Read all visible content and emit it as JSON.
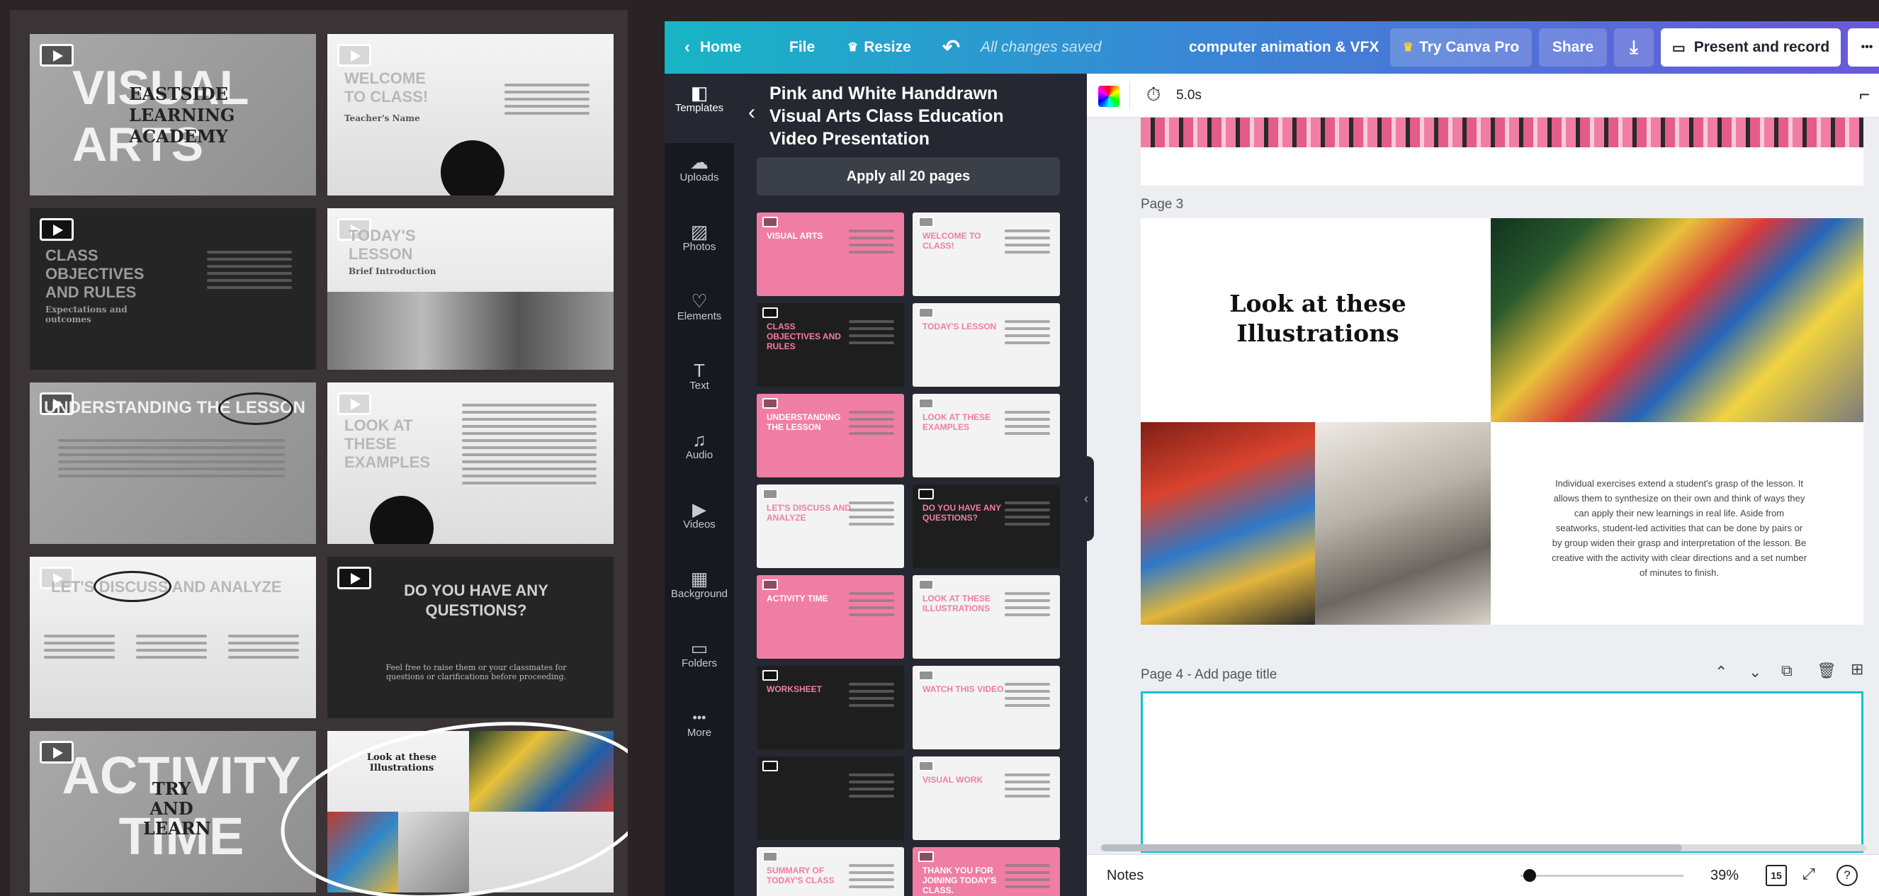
{
  "zoom_panel": {
    "slides": [
      {
        "title_big": "VISUAL ARTS",
        "subtitle": "EASTSIDE LEARNING ACADEMY"
      },
      {
        "title": "WELCOME TO CLASS!",
        "subtitle": "Teacher's Name"
      },
      {
        "title": "CLASS OBJECTIVES AND RULES",
        "subtitle": "Expectations and outcomes"
      },
      {
        "title": "TODAY'S LESSON",
        "subtitle": "Brief Introduction"
      },
      {
        "title": "UNDERSTANDING THE LESSON"
      },
      {
        "title": "LOOK AT THESE EXAMPLES"
      },
      {
        "title": "LET'S DISCUSS AND ANALYZE"
      },
      {
        "title": "DO YOU HAVE ANY QUESTIONS?",
        "subtitle": "Feel free to raise them or your classmates for questions or clarifications before proceeding."
      },
      {
        "title_big": "ACTIVITY TIME",
        "subtitle": "TRY AND LEARN"
      },
      {
        "title": "Look at these Illustrations"
      }
    ]
  },
  "topbar": {
    "home": "Home",
    "file": "File",
    "resize": "Resize",
    "saved": "All changes saved",
    "doc_title": "computer animation & VFX",
    "try_pro": "Try Canva Pro",
    "share": "Share",
    "present": "Present and record",
    "more": "•••"
  },
  "rail": {
    "items": [
      {
        "label": "Templates",
        "icon": "templates-icon",
        "glyph": "◧"
      },
      {
        "label": "Uploads",
        "icon": "upload-cloud-icon",
        "glyph": "☁"
      },
      {
        "label": "Photos",
        "icon": "photo-icon",
        "glyph": "▨"
      },
      {
        "label": "Elements",
        "icon": "shapes-icon",
        "glyph": "♡"
      },
      {
        "label": "Text",
        "icon": "text-icon",
        "glyph": "T"
      },
      {
        "label": "Audio",
        "icon": "music-note-icon",
        "glyph": "♫"
      },
      {
        "label": "Videos",
        "icon": "video-icon",
        "glyph": "▶"
      },
      {
        "label": "Background",
        "icon": "background-pattern-icon",
        "glyph": "▦"
      },
      {
        "label": "Folders",
        "icon": "folder-icon",
        "glyph": "▭"
      },
      {
        "label": "More",
        "icon": "more-dots-icon",
        "glyph": "•••"
      }
    ]
  },
  "templates_panel": {
    "title_line1": "Pink and White Handdrawn",
    "title_line2": "Visual Arts Class Education",
    "title_line3": "Video Presentation",
    "apply_label": "Apply all 20 pages",
    "thumbs": [
      {
        "text": "VISUAL ARTS",
        "style": "pink"
      },
      {
        "text": "WELCOME TO CLASS!",
        "style": "light"
      },
      {
        "text": "CLASS OBJECTIVES AND RULES",
        "style": "dark"
      },
      {
        "text": "TODAY'S LESSON",
        "style": "light"
      },
      {
        "text": "UNDERSTANDING THE LESSON",
        "style": "pink"
      },
      {
        "text": "LOOK AT THESE EXAMPLES",
        "style": "light"
      },
      {
        "text": "LET'S DISCUSS AND ANALYZE",
        "style": "light"
      },
      {
        "text": "DO YOU HAVE ANY QUESTIONS?",
        "style": "dark"
      },
      {
        "text": "ACTIVITY TIME",
        "style": "pink"
      },
      {
        "text": "Look at these Illustrations",
        "style": "light"
      },
      {
        "text": "WORKSHEET",
        "style": "dark"
      },
      {
        "text": "WATCH THIS VIDEO",
        "style": "light"
      },
      {
        "text": "",
        "style": "dark"
      },
      {
        "text": "VISUAL WORK",
        "style": "light"
      },
      {
        "text": "SUMMARY OF TODAY'S CLASS",
        "style": "light"
      },
      {
        "text": "THANK YOU FOR JOINING TODAY'S CLASS.",
        "style": "pink"
      }
    ]
  },
  "canvas": {
    "duration": "5.0s",
    "page3_label": "Page 3",
    "slide_title": "Look at these Illustrations",
    "slide_body": "Individual exercises extend a student's grasp of the lesson. It allows them to synthesize on their own and think of ways they can apply their new learnings in real life. Aside from seatworks, student-led activities that can be done by pairs or by group widen their grasp and interpretation of the lesson. Be creative with the activity with clear directions and a set number of minutes to finish.",
    "page4_label": "Page 4 - Add page title"
  },
  "bottombar": {
    "notes": "Notes",
    "zoom": "39%",
    "page_count": "15"
  },
  "colors": {
    "accent_pink": "#f07ea4",
    "topbar_start": "#17b5c6",
    "topbar_end": "#6a58d8",
    "selection": "#13c2d0"
  }
}
